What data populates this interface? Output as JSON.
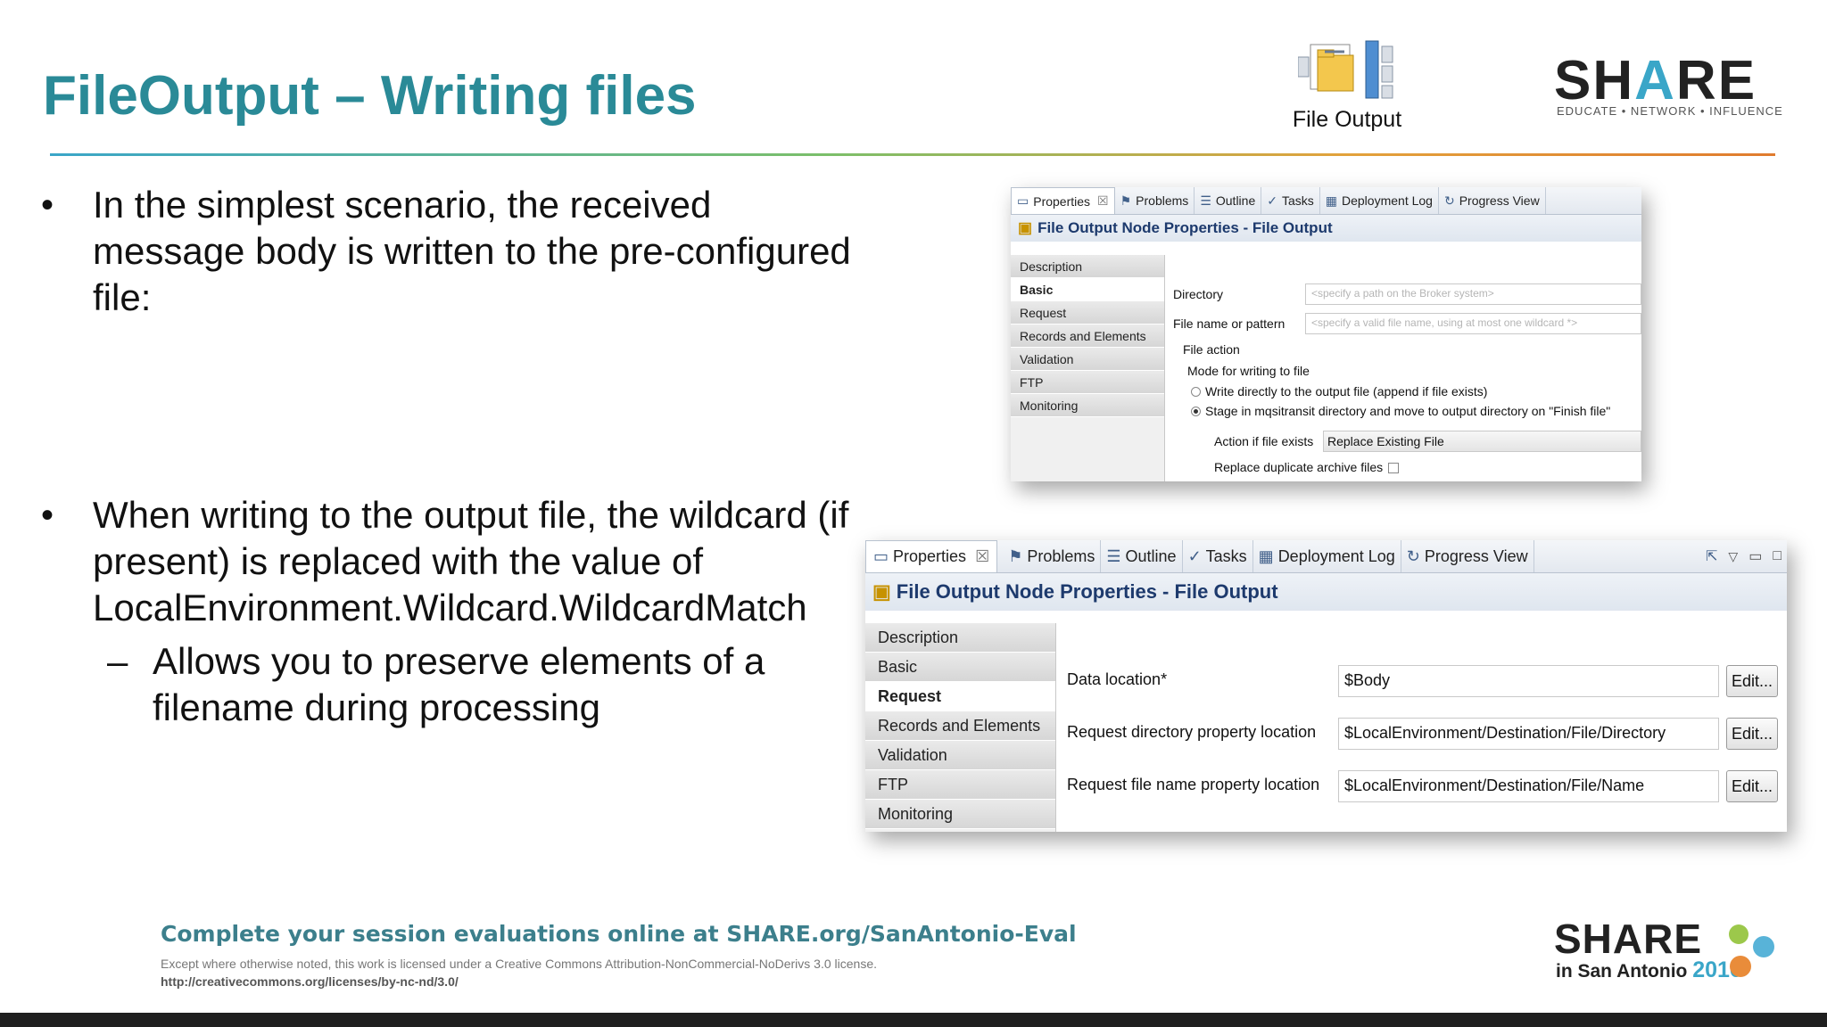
{
  "slide": {
    "title": "FileOutput – Writing files",
    "node_label": "File Output",
    "logo_text_left": "SH",
    "logo_text_a": "A",
    "logo_text_right": "RE",
    "logo_tagline": "EDUCATE • NETWORK • INFLUENCE"
  },
  "bullets": {
    "b1_marker": "•",
    "b1_line1": "In the simplest scenario, the received",
    "b1_line2": "message body is written to the pre-configured",
    "b1_line3": "file:",
    "b2_marker": "•",
    "b2_line1": "When writing to the output file, the wildcard (if",
    "b2_line2": "present) is replaced with the value of",
    "b2_line3": "LocalEnvironment.Wildcard.WildcardMatch",
    "sub_marker": "–",
    "sub_line1": "Allows you to preserve elements of a",
    "sub_line2": "filename during processing"
  },
  "panel1": {
    "tabs": [
      "Properties",
      "Problems",
      "Outline",
      "Tasks",
      "Deployment Log",
      "Progress View"
    ],
    "close_glyph": "☒",
    "title": "File Output Node Properties - File Output",
    "side": [
      "Description",
      "Basic",
      "Request",
      "Records and Elements",
      "Validation",
      "FTP",
      "Monitoring"
    ],
    "directory_label": "Directory",
    "directory_placeholder": "<specify a path on the Broker system>",
    "filename_label": "File name or pattern",
    "filename_placeholder": "<specify a valid file name, using at most one wildcard *>",
    "file_action_label": "File action",
    "mode_label": "Mode for writing to file",
    "radio1": "Write directly to the output file (append if file exists)",
    "radio2": "Stage in mqsitransit directory and move to output directory on \"Finish file\"",
    "action_label": "Action if file exists",
    "action_value": "Replace Existing File",
    "replace_label": "Replace duplicate archive files"
  },
  "panel2": {
    "tabs": [
      "Properties",
      "Problems",
      "Outline",
      "Tasks",
      "Deployment Log",
      "Progress View"
    ],
    "close_glyph": "☒",
    "title": "File Output Node Properties - File Output",
    "side": [
      "Description",
      "Basic",
      "Request",
      "Records and Elements",
      "Validation",
      "FTP",
      "Monitoring"
    ],
    "rows": [
      {
        "label": "Data location*",
        "value": "$Body",
        "button": "Edit..."
      },
      {
        "label": "Request directory property location",
        "value": "$LocalEnvironment/Destination/File/Directory",
        "button": "Edit..."
      },
      {
        "label": "Request file name property location",
        "value": "$LocalEnvironment/Destination/File/Name",
        "button": "Edit..."
      }
    ]
  },
  "footer": {
    "eval": "Complete your session evaluations online at SHARE.org/SanAntonio-Eval",
    "license1": "Except where otherwise noted, this work is licensed under a Creative Commons Attribution-NonCommercial-NoDerivs 3.0 license.",
    "license2": "http://creativecommons.org/licenses/by-nc-nd/3.0/",
    "share": "SHARE",
    "in_city": "in San Antonio ",
    "year": "2016"
  },
  "colors": {
    "title": "#2a8a97",
    "panel_title": "#1d3a6d",
    "accent": "#3aa6c8"
  }
}
